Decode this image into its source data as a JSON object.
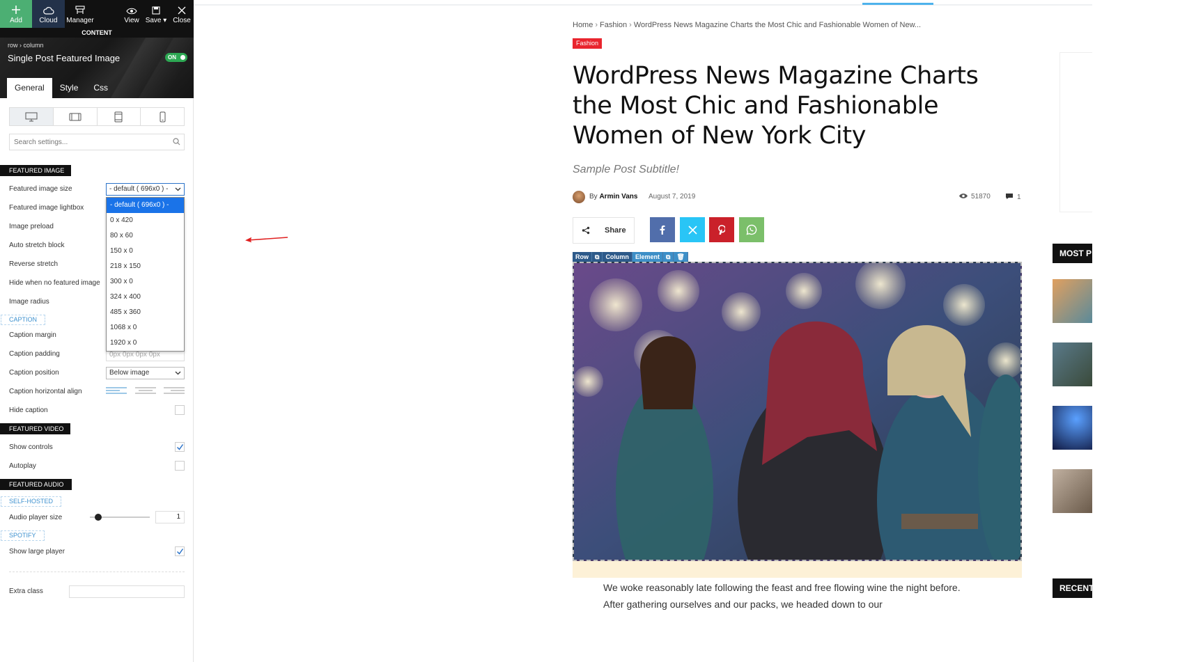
{
  "toolbar": {
    "add": "Add",
    "cloud": "Cloud",
    "manager": "Manager",
    "view": "View",
    "save": "Save ▾",
    "close": "Close"
  },
  "panel": {
    "section_label": "CONTENT",
    "breadcrumb": "row › column",
    "element_title": "Single Post Featured Image",
    "toggle_label": "ON",
    "tabs": [
      "General",
      "Style",
      "Css"
    ],
    "search_placeholder": "Search settings..."
  },
  "featured_image": {
    "heading": "FEATURED IMAGE",
    "size_label": "Featured image size",
    "size_value": "- default ( 696x0 ) -",
    "size_options": [
      "- default ( 696x0 ) -",
      "0 x 420",
      "80 x 60",
      "150 x 0",
      "218 x 150",
      "300 x 0",
      "324 x 400",
      "485 x 360",
      "1068 x 0",
      "1920 x 0"
    ],
    "lightbox_label": "Featured image lightbox",
    "preload_label": "Image preload",
    "auto_stretch_label": "Auto stretch block",
    "reverse_stretch_label": "Reverse stretch",
    "hide_no_image_label": "Hide when no featured image",
    "radius_label": "Image radius"
  },
  "caption": {
    "heading": "CAPTION",
    "margin_label": "Caption margin",
    "padding_label": "Caption padding",
    "padding_placeholder": "0px 0px 0px 0px",
    "position_label": "Caption position",
    "position_value": "Below image",
    "halign_label": "Caption horizontal align",
    "hide_label": "Hide caption",
    "hide_checked": false
  },
  "featured_video": {
    "heading": "FEATURED VIDEO",
    "controls_label": "Show controls",
    "controls_checked": true,
    "autoplay_label": "Autoplay",
    "autoplay_checked": false
  },
  "featured_audio": {
    "heading": "FEATURED AUDIO",
    "self_hosted": "SELF-HOSTED",
    "player_size_label": "Audio player size",
    "player_size_value": "1",
    "spotify": "SPOTIFY",
    "large_player_label": "Show large player",
    "large_player_checked": true
  },
  "extra_class_label": "Extra class",
  "article": {
    "breadcrumb": [
      "Home",
      "Fashion",
      "WordPress News Magazine Charts the Most Chic and Fashionable Women of New..."
    ],
    "category": "Fashion",
    "title": "WordPress News Magazine Charts the Most Chic and Fashionable Women of New York City",
    "subtitle": "Sample Post Subtitle!",
    "by": "By",
    "author": "Armin Vans",
    "date": "August 7, 2019",
    "views": "51870",
    "comments": "1",
    "share_label": "Share",
    "social": [
      {
        "name": "facebook",
        "color": "#516eab"
      },
      {
        "name": "x",
        "color": "#29c5f6"
      },
      {
        "name": "pinterest",
        "color": "#ca212a"
      },
      {
        "name": "whatsapp",
        "color": "#7bbf6a"
      }
    ],
    "controls": [
      "Row",
      "Column",
      "Element"
    ],
    "body": "We woke reasonably late following the feast and free flowing wine the night before. After gathering ourselves and our packs, we headed down to our"
  },
  "right_sidebar": {
    "most_popular": "MOST P",
    "recent": "RECENT"
  },
  "colors": {
    "accent": "#4db2ec",
    "category": "#e9252e",
    "toolbar_add": "#4caf73",
    "toolbar_cloud": "#23324a",
    "toggle_on": "#2da853"
  }
}
